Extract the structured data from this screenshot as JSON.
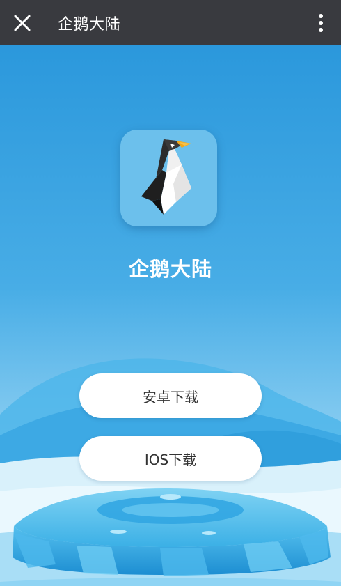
{
  "topbar": {
    "title": "企鹅大陆",
    "close_icon": "close-icon",
    "more_icon": "more-vertical-icon"
  },
  "app": {
    "name": "企鹅大陆",
    "icon": "penguin-logo"
  },
  "downloads": {
    "android_label": "安卓下载",
    "ios_label": "IOS下载"
  },
  "colors": {
    "topbar_bg": "#393a3f",
    "sky_top": "#2b98dc",
    "sky_bottom": "#8fd0f2",
    "icon_bg": "#6cc0ec",
    "button_bg": "#ffffff",
    "button_text": "#333333"
  }
}
